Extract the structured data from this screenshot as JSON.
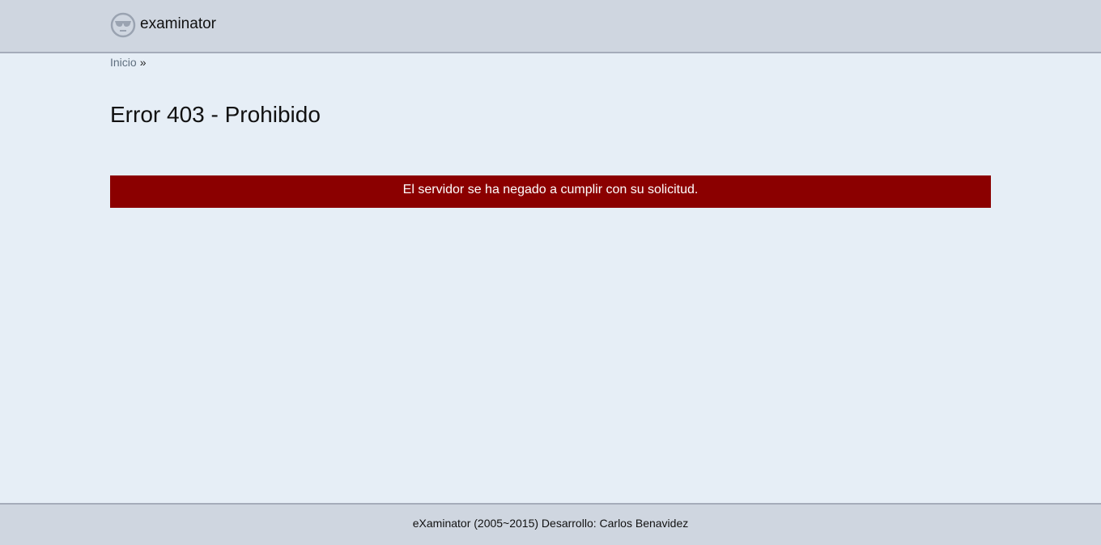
{
  "header": {
    "brand_icon": "sunglasses-face-icon",
    "brand_name": "examinator"
  },
  "breadcrumb": {
    "home_label": "Inicio",
    "separator": "»"
  },
  "main": {
    "title": "Error 403 - Prohibido",
    "alert_message": "El servidor se ha negado a cumplir con su solicitud."
  },
  "footer": {
    "text": "eXaminator (2005~2015) Desarrollo: Carlos Benavidez"
  },
  "colors": {
    "header_bg": "#cfd6e0",
    "page_bg": "#e6eef6",
    "alert_bg": "#8b0000",
    "alert_text": "#ffffff",
    "link": "#5f6f7f"
  }
}
